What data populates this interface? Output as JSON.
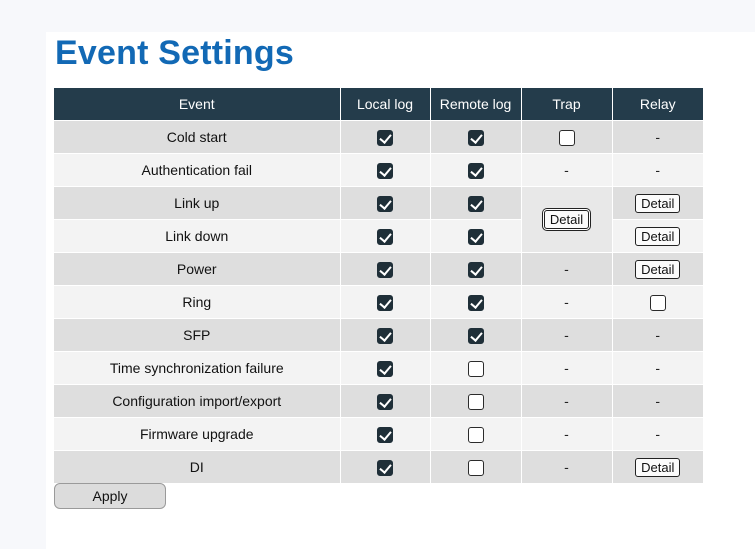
{
  "page": {
    "title": "Event Settings"
  },
  "table": {
    "headers": {
      "event": "Event",
      "local_log": "Local log",
      "remote_log": "Remote log",
      "trap": "Trap",
      "relay": "Relay"
    },
    "rows": [
      {
        "event": "Cold start",
        "local_log": true,
        "remote_log": true,
        "trap": "unchecked",
        "relay": "-"
      },
      {
        "event": "Authentication fail",
        "local_log": true,
        "remote_log": true,
        "trap": "-",
        "relay": "-"
      },
      {
        "event": "Link up",
        "local_log": true,
        "remote_log": true,
        "trap": "Detail",
        "relay": "Detail"
      },
      {
        "event": "Link down",
        "local_log": true,
        "remote_log": true,
        "trap": "Detail",
        "relay": "Detail"
      },
      {
        "event": "Power",
        "local_log": true,
        "remote_log": true,
        "trap": "-",
        "relay": "Detail"
      },
      {
        "event": "Ring",
        "local_log": true,
        "remote_log": true,
        "trap": "-",
        "relay": "unchecked"
      },
      {
        "event": "SFP",
        "local_log": true,
        "remote_log": true,
        "trap": "-",
        "relay": "-"
      },
      {
        "event": "Time synchronization failure",
        "local_log": true,
        "remote_log": false,
        "trap": "-",
        "relay": "-"
      },
      {
        "event": "Configuration import/export",
        "local_log": true,
        "remote_log": false,
        "trap": "-",
        "relay": "-"
      },
      {
        "event": "Firmware upgrade",
        "local_log": true,
        "remote_log": false,
        "trap": "-",
        "relay": "-"
      },
      {
        "event": "DI",
        "local_log": true,
        "remote_log": false,
        "trap": "-",
        "relay": "Detail"
      }
    ],
    "detail_label": "Detail",
    "dash": "-"
  },
  "footer": {
    "apply_label": "Apply"
  },
  "colors": {
    "title": "#1269b5",
    "header_bg": "#243c4b",
    "row_dark": "#dedede",
    "row_light": "#f3f3f3"
  }
}
